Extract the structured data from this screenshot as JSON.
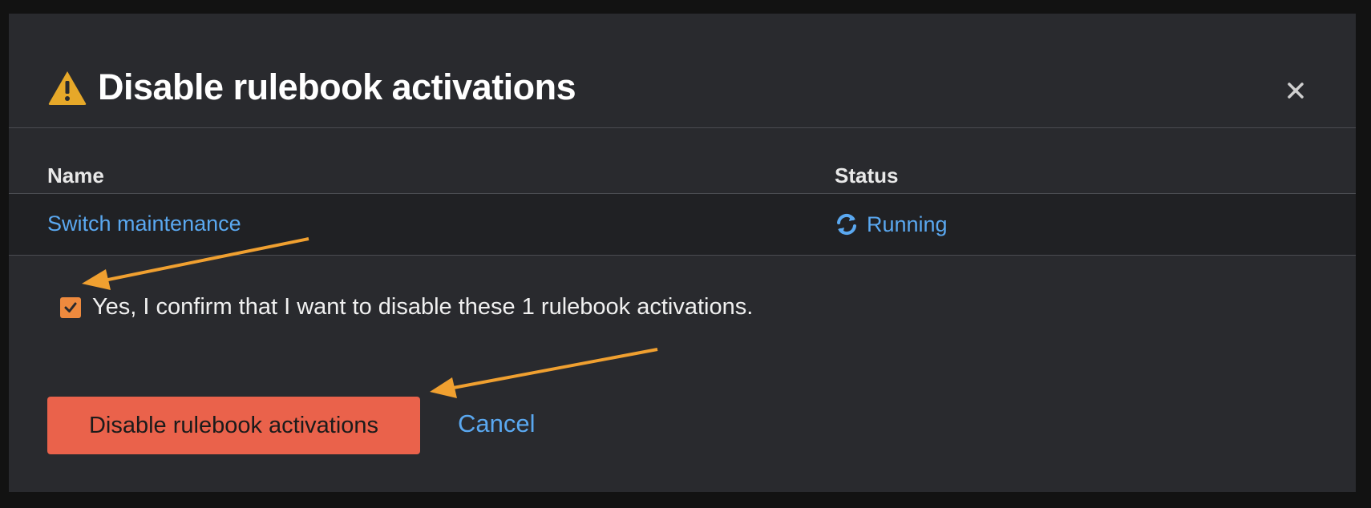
{
  "dialog": {
    "title": "Disable rulebook activations",
    "warning_icon": "warning-triangle-icon",
    "close_icon": "close-icon"
  },
  "table": {
    "columns": [
      "Name",
      "Status"
    ],
    "rows": [
      {
        "name": "Switch maintenance",
        "status": "Running",
        "status_icon": "sync-icon"
      }
    ]
  },
  "confirm": {
    "checked": true,
    "label": "Yes, I confirm that I want to disable these 1 rulebook activations."
  },
  "actions": {
    "primary_label": "Disable rulebook activations",
    "cancel_label": "Cancel"
  },
  "colors": {
    "accent_link": "#5aa8f0",
    "danger_button": "#ea624b",
    "checkbox": "#ee8a3e",
    "warning": "#e6a829",
    "annotation_arrow": "#f0a030"
  }
}
